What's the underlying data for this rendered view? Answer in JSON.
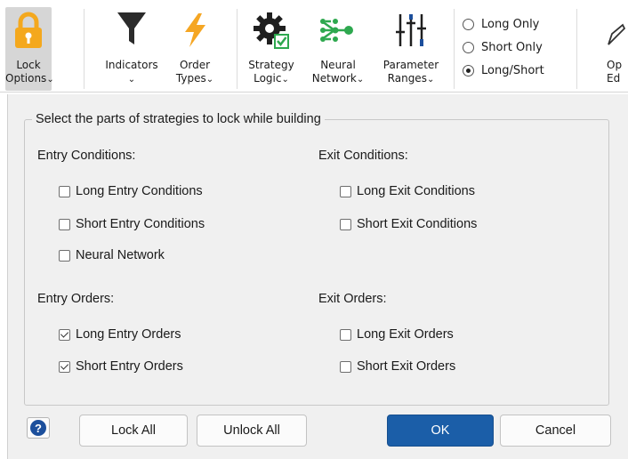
{
  "ribbon": {
    "lock_options": {
      "line1": "Lock",
      "line2": "Options"
    },
    "indicators": {
      "line1": "Indicators"
    },
    "order_types": {
      "line1": "Order",
      "line2": "Types"
    },
    "strategy_logic": {
      "line1": "Strategy",
      "line2": "Logic"
    },
    "neural_network": {
      "line1": "Neural",
      "line2": "Network"
    },
    "parameter_ranges": {
      "line1": "Parameter",
      "line2": "Ranges"
    },
    "direction": [
      {
        "label": "Long Only",
        "selected": false
      },
      {
        "label": "Short Only",
        "selected": false
      },
      {
        "label": "Long/Short",
        "selected": true
      }
    ],
    "cut_off": {
      "line1": "Op",
      "line2": "Ed"
    },
    "chevron": "⌄",
    "colors": {
      "lock_body": "#f4a81d",
      "lightning": "#f5a623",
      "neural": "#2ea84f",
      "gear": "#1f1f1f",
      "funnel": "#2b2b2b"
    }
  },
  "dialog": {
    "group_title": "Select the parts of strategies to lock while building",
    "entry_conditions": {
      "title": "Entry Conditions:",
      "items": [
        {
          "label": "Long Entry Conditions",
          "checked": false
        },
        {
          "label": "Short Entry Conditions",
          "checked": false
        },
        {
          "label": "Neural Network",
          "checked": false
        }
      ]
    },
    "exit_conditions": {
      "title": "Exit Conditions:",
      "items": [
        {
          "label": "Long Exit Conditions",
          "checked": false
        },
        {
          "label": "Short Exit Conditions",
          "checked": false
        }
      ]
    },
    "entry_orders": {
      "title": "Entry Orders:",
      "items": [
        {
          "label": "Long Entry Orders",
          "checked": true
        },
        {
          "label": "Short Entry Orders",
          "checked": true
        }
      ]
    },
    "exit_orders": {
      "title": "Exit Orders:",
      "items": [
        {
          "label": "Long Exit Orders",
          "checked": false
        },
        {
          "label": "Short Exit Orders",
          "checked": false
        }
      ]
    },
    "buttons": {
      "help": "?",
      "lock_all": "Lock All",
      "unlock_all": "Unlock All",
      "ok": "OK",
      "cancel": "Cancel"
    },
    "colors": {
      "primary": "#1b5ea8",
      "help": "#1c4f9c"
    }
  }
}
